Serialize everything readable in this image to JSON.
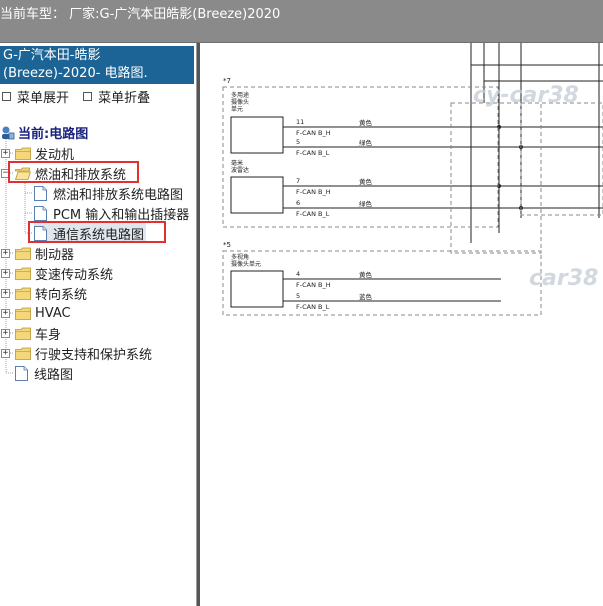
{
  "header": {
    "vehicle_info": "当前车型：   厂家:G-广汽本田皓影(Breeze)2020"
  },
  "sidebar": {
    "panel_title_line1": "G-广汽本田-皓影",
    "panel_title_line2": "(Breeze)-2020- 电路图.",
    "menu_expand": "菜单展开",
    "menu_collapse": "菜单折叠",
    "current_label": "当前:电路图",
    "tree": [
      {
        "label": "发动机",
        "expander": "+"
      },
      {
        "label": "燃油和排放系统",
        "expander": "−"
      },
      {
        "label": "燃油和排放系统电路图"
      },
      {
        "label": "PCM 输入和输出插接器"
      },
      {
        "label": "通信系统电路图"
      },
      {
        "label": "制动器",
        "expander": "+"
      },
      {
        "label": "变速传动系统",
        "expander": "+"
      },
      {
        "label": "转向系统",
        "expander": "+"
      },
      {
        "label": "HVAC",
        "expander": "+"
      },
      {
        "label": "车身",
        "expander": "+"
      },
      {
        "label": "行驶支持和保护系统",
        "expander": "+"
      },
      {
        "label": "线路图"
      }
    ]
  },
  "diagram": {
    "watermark_1": "cy-car38",
    "watermark_2": "car38",
    "ref_7": "*7",
    "ref_5": "*5",
    "comp_multi_camera_l1": "多用途",
    "comp_multi_camera_l2": "摄像头",
    "comp_multi_camera_l3": "单元",
    "comp_radar_l1": "毫米",
    "comp_radar_l2": "波雷达",
    "comp_view_camera_l1": "多视角",
    "comp_view_camera_l2": "摄像头单元",
    "pins": [
      {
        "pin": "11",
        "signal": "F-CAN B_H",
        "color": "黄色"
      },
      {
        "pin": "5",
        "signal": "F-CAN B_L",
        "color": "绿色"
      },
      {
        "pin": "7",
        "signal": "F-CAN B_H",
        "color": "黄色"
      },
      {
        "pin": "6",
        "signal": "F-CAN B_L",
        "color": "绿色"
      },
      {
        "pin": "4",
        "signal": "F-CAN B_H",
        "color": "黄色"
      },
      {
        "pin": "5",
        "signal": "F-CAN B_L",
        "color": "蓝色"
      }
    ]
  },
  "colors": {
    "title_bar": "#8a8a8a",
    "panel_header": "#1c6496",
    "highlight": "#e03030",
    "current_label": "#1a237e"
  }
}
